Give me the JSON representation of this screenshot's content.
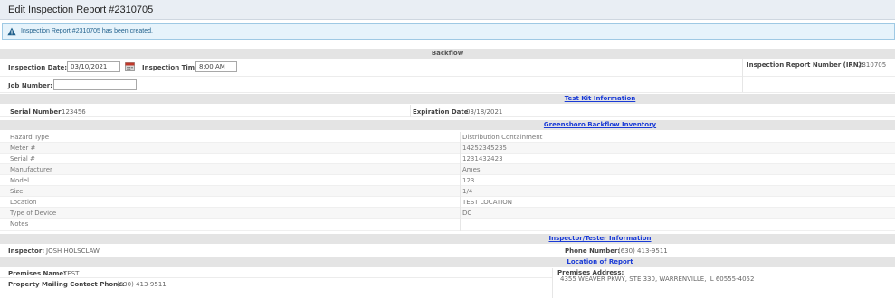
{
  "header": {
    "title": "Edit Inspection Report #2310705"
  },
  "alert": {
    "message": "Inspection Report #2310705 has been created."
  },
  "backflow": {
    "heading": "Backflow",
    "inspection_date_label": "Inspection Date:",
    "inspection_date_value": "03/10/2021",
    "inspection_time_label": "Inspection Time",
    "inspection_time_value": "8:00 AM",
    "irn_label": "Inspection Report Number (IRN):",
    "irn_value": "2310705",
    "job_number_label": "Job Number:",
    "job_number_value": ""
  },
  "test_kit": {
    "heading": "Test Kit Information",
    "serial_label": "Serial Number",
    "serial_value": "123456",
    "expiration_label": "Expiration Date",
    "expiration_value": "03/18/2021"
  },
  "inventory": {
    "heading": "Greensboro Backflow Inventory",
    "rows": [
      {
        "label": "Hazard Type",
        "value": "Distribution Containment"
      },
      {
        "label": "Meter #",
        "value": "14252345235"
      },
      {
        "label": "Serial #",
        "value": "1231432423"
      },
      {
        "label": "Manufacturer",
        "value": "Ames"
      },
      {
        "label": "Model",
        "value": "123"
      },
      {
        "label": "Size",
        "value": "1/4"
      },
      {
        "label": "Location",
        "value": "TEST LOCATION"
      },
      {
        "label": "Type of Device",
        "value": "DC"
      },
      {
        "label": "Notes",
        "value": ""
      }
    ]
  },
  "inspector": {
    "heading": "Inspector/Tester Information",
    "inspector_label": "Inspector:",
    "inspector_value": "JOSH HOLSCLAW",
    "phone_label": "Phone Number:",
    "phone_value": "(630) 413-9511"
  },
  "location": {
    "heading": "Location of Report",
    "premises_name_label": "Premises Name:",
    "premises_name_value": "TEST",
    "premises_address_label": "Premises Address:",
    "premises_address_value": "4355 WEAVER PKWY, STE 330, WARRENVILLE, IL 60555-4052",
    "mailing_phone_label": "Property Mailing Contact Phone:",
    "mailing_phone_value": "(630) 413-9511"
  },
  "colors": {
    "link": "#1a3bd6",
    "alert_bg": "#e6f3fb",
    "section_bar": "#e4e4e4"
  },
  "icons": {
    "alert": "warning-triangle-icon",
    "date_picker": "calendar-icon"
  }
}
